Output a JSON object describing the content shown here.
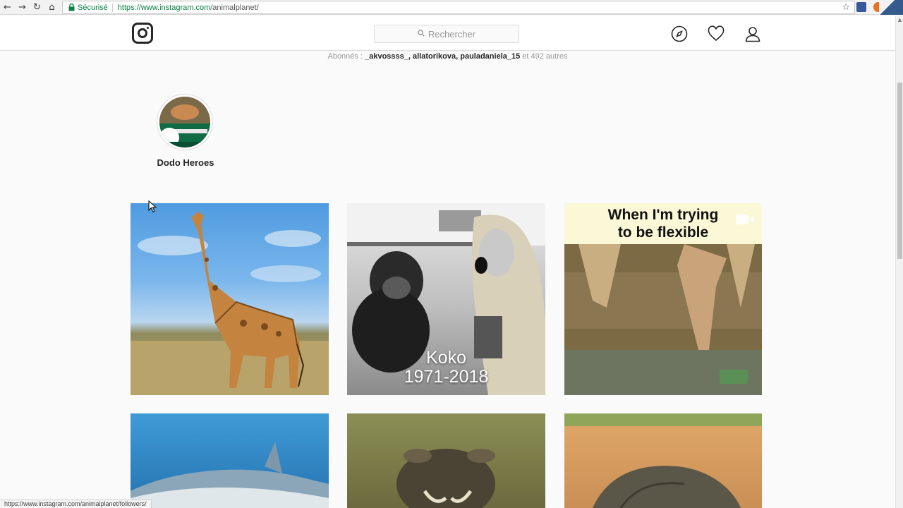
{
  "browser": {
    "secure_label": "Sécurisé",
    "url_host": "https://www.instagram.com",
    "url_path": "/animalplanet/"
  },
  "header": {
    "search_placeholder": "Rechercher"
  },
  "profile": {
    "followers_prefix": "Abonnés :",
    "followers_names": "_akvossss_, allatorikova, pauladaniela_15",
    "followers_suffix": "et 492 autres"
  },
  "highlights": [
    {
      "label": "Dodo Heroes"
    }
  ],
  "posts": [
    {
      "name": "giraffe",
      "caption": "",
      "overlay_text": ""
    },
    {
      "name": "koko-gorilla",
      "overlay_text_1": "Koko",
      "overlay_text_2": "1971-2018"
    },
    {
      "name": "giraffe-drinking",
      "caption_1": "When I'm trying",
      "caption_2": "to be flexible",
      "video": true
    },
    {
      "name": "shark"
    },
    {
      "name": "warthog"
    },
    {
      "name": "komodo-dragon"
    }
  ],
  "status_bar": {
    "text": "https://www.instagram.com/animalplanet/followers/"
  }
}
